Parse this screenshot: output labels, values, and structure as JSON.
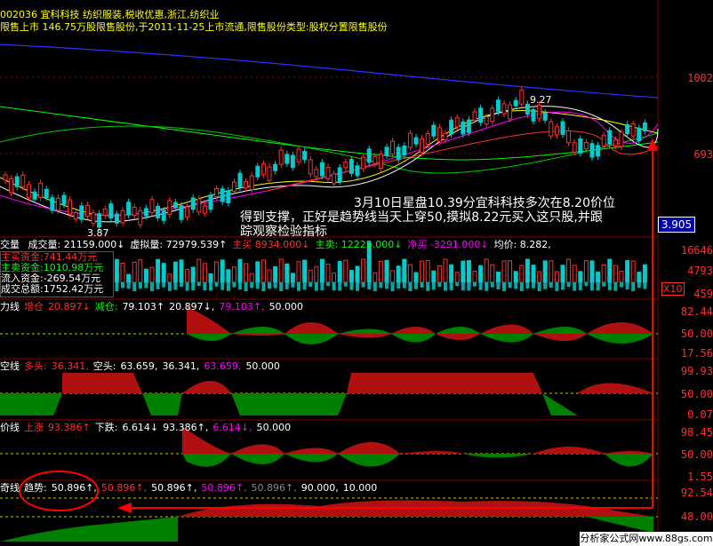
{
  "header": {
    "line1": "002036 宜科科技 纺织服装,税收优惠,浙江,纺织业",
    "line2": "限售上市  146.75万股限售股份,于2011-11-25上市流通,限售股份类型:股权分置限售股份"
  },
  "main_chart": {
    "label_high": "9.27",
    "label_low": "3.87",
    "axis_top": "1002",
    "axis_mid": "693",
    "price_tag": "3.905",
    "annotation_line1": "3月10日星盘10.39分宜科科技多次在8.20价位",
    "annotation_line2": "得到支撑，正好是趋势线当天上穿50,摸拟8.22元买入这只股,并跟",
    "annotation_line3": "踪观察检验指标",
    "colors": {
      "up": "#ff3030",
      "down": "#00cccc",
      "ma1": "#ffffff",
      "ma2": "#ffff00",
      "ma3": "#ff00ff",
      "ma4": "#00ff00",
      "ma5": "#3030ff"
    }
  },
  "volume_panel": {
    "title": "交量",
    "items": [
      {
        "label": "成交量:",
        "value": "21159.000↓",
        "color": "#ffffff"
      },
      {
        "label": "虚拟量:",
        "value": "72979.539↑",
        "color": "#ffffff"
      },
      {
        "label": "主买",
        "value": "8934.000↓",
        "color": "#ff3030"
      },
      {
        "label": "主卖:",
        "value": "12225.000↓",
        "color": "#00ff00"
      },
      {
        "label": "净买",
        "value": "-3291.000↓",
        "color": "#ff00ff"
      },
      {
        "label": "均价:",
        "value": "8.282,",
        "color": "#ffffff"
      }
    ],
    "info_box": [
      "主买资金:741.44万元",
      "主卖资金:1010.98万元",
      "流入资金:-269.54万元",
      "成交总额:1752.42万元"
    ],
    "axis": [
      "16646",
      "4793",
      "459"
    ],
    "multiplier": "X10"
  },
  "indicator_panels": [
    {
      "title": "力线",
      "items": [
        {
          "t": "增仓",
          "c": "#ff3030"
        },
        {
          "t": "20.897↓",
          "c": "#ff3030"
        },
        {
          "t": "减仓:",
          "c": "#00ff00"
        },
        {
          "t": "79.103↑",
          "c": "#ffffff"
        },
        {
          "t": "20.897↓,",
          "c": "#ffffff"
        },
        {
          "t": "79.103↑,",
          "c": "#ff00ff"
        },
        {
          "t": "50.000",
          "c": "#ffffff"
        }
      ],
      "axis": [
        "82.44",
        "50.00",
        "17.56"
      ]
    },
    {
      "title": "空线",
      "items": [
        {
          "t": "多头:",
          "c": "#ff3030"
        },
        {
          "t": "36.341,",
          "c": "#ff3030"
        },
        {
          "t": "空头:",
          "c": "#ffffff"
        },
        {
          "t": "63.659,",
          "c": "#ffffff"
        },
        {
          "t": "36.341,",
          "c": "#ffffff"
        },
        {
          "t": "63.659,",
          "c": "#ff00ff"
        },
        {
          "t": "50.000",
          "c": "#ffffff"
        }
      ],
      "axis": [
        "99.93",
        "50.00",
        "0.07"
      ]
    },
    {
      "title": "价线",
      "items": [
        {
          "t": "上涨",
          "c": "#ff3030"
        },
        {
          "t": "93.386↑",
          "c": "#ff3030"
        },
        {
          "t": "下跌:",
          "c": "#ffffff"
        },
        {
          "t": "6.614↓",
          "c": "#ffffff"
        },
        {
          "t": "93.386↑,",
          "c": "#ffffff"
        },
        {
          "t": "6.614↓,",
          "c": "#ff00ff"
        },
        {
          "t": "50.000",
          "c": "#ffffff"
        }
      ],
      "axis": [
        "98.45",
        "50.00",
        "1.55"
      ]
    },
    {
      "title": "奇线",
      "items": [
        {
          "t": "趋势:",
          "c": "#ffffff"
        },
        {
          "t": "50.896↑,",
          "c": "#ffffff"
        },
        {
          "t": "50.896↑,",
          "c": "#ff3030"
        },
        {
          "t": "50.896↑,",
          "c": "#ffffff"
        },
        {
          "t": "50.896↑,",
          "c": "#ff00ff"
        },
        {
          "t": "50.896↑,",
          "c": "#888888"
        },
        {
          "t": "90.000,",
          "c": "#ffffff"
        },
        {
          "t": "10.000",
          "c": "#ffffff"
        }
      ],
      "axis": [
        "92.54",
        "48.00"
      ]
    }
  ],
  "watermark": "分析家公式网www.88gs.com"
}
